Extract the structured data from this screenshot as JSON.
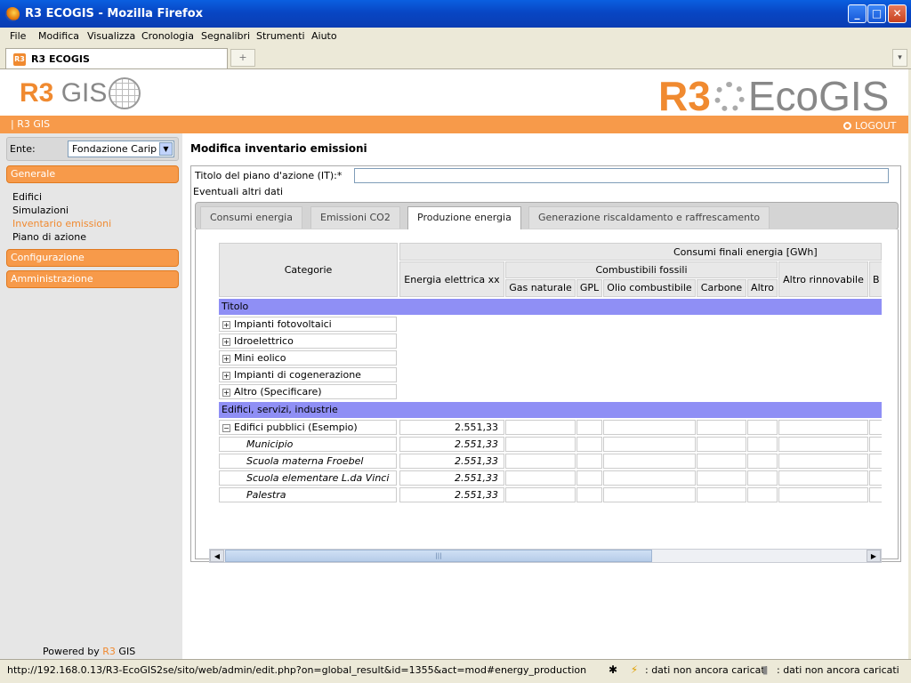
{
  "window": {
    "title": "R3 ECOGIS - Mozilla Firefox",
    "min": "_",
    "max": "□",
    "close": "✕"
  },
  "menu": [
    "File",
    "Modifica",
    "Visualizza",
    "Cronologia",
    "Segnalibri",
    "Strumenti",
    "Aiuto"
  ],
  "browser_tab": {
    "label": "R3 ECOGIS",
    "new_tab": "+",
    "dropdown": "▾"
  },
  "header": {
    "logo_left_r3": "R3",
    "logo_left_gis": "GIS",
    "logo_right_r3": "R3",
    "logo_right_eco": "EcoGIS"
  },
  "breadcrumb": "| R3 GIS",
  "logout": "LOGOUT",
  "sidebar": {
    "ente_label": "Ente:",
    "ente_value": "Fondazione Carip",
    "sections": [
      "Generale",
      "Configurazione",
      "Amministrazione"
    ],
    "items": [
      "Edifici",
      "Simulazioni",
      "Inventario emissioni",
      "Piano di azione"
    ],
    "powered_prefix": "Powered by",
    "powered_brand": "R3",
    "powered_suffix": "GIS"
  },
  "main": {
    "title": "Modifica inventario emissioni",
    "field_label": "Titolo del piano d'azione (IT):*",
    "field_value": "",
    "altri": "Eventuali altri dati",
    "tabs": [
      "Consumi energia",
      "Emissioni CO2",
      "Produzione energia",
      "Generazione riscaldamento e raffrescamento"
    ],
    "selected_tab": 2
  },
  "grid": {
    "h_categorie": "Categorie",
    "h_consumi": "Consumi finali energia [GWh]",
    "h_energia_elettrica": "Energia elettrica xx",
    "h_combustibili": "Combustibili fossili",
    "h_gas": "Gas naturale",
    "h_gpl": "GPL",
    "h_olio": "Olio combustibile",
    "h_carbone": "Carbone",
    "h_altro": "Altro",
    "h_altro_rinnovabile": "Altro rinnovabile",
    "h_b": "B",
    "group1": "Titolo",
    "group1_rows": [
      "Impianti fotovoltaici",
      "Idroelettrico",
      "Mini eolico",
      "Impianti di cogenerazione",
      "Altro (Specificare)"
    ],
    "group2": "Edifici, servizi, industrie",
    "parent_row": {
      "label": "Edifici pubblici (Esempio)",
      "value": "2.551,33"
    },
    "child_rows": [
      {
        "label": "Municipio",
        "value": "2.551,33"
      },
      {
        "label": "Scuola materna Froebel",
        "value": "2.551,33"
      },
      {
        "label": "Scuola elementare L.da Vinci",
        "value": "2.551,33"
      },
      {
        "label": "Palestra",
        "value": "2.551,33"
      }
    ],
    "scroll_left": "◀",
    "scroll_right": "▶",
    "scroll_grip": "|||"
  },
  "status": {
    "url": "http://192.168.0.13/R3-EcoGIS2se/sito/web/admin/edit.php?on=global_result&id=1355&act=mod#energy_production",
    "s1": ": dati non ancora caricati",
    "s2": ": dati non ancora caricati"
  }
}
